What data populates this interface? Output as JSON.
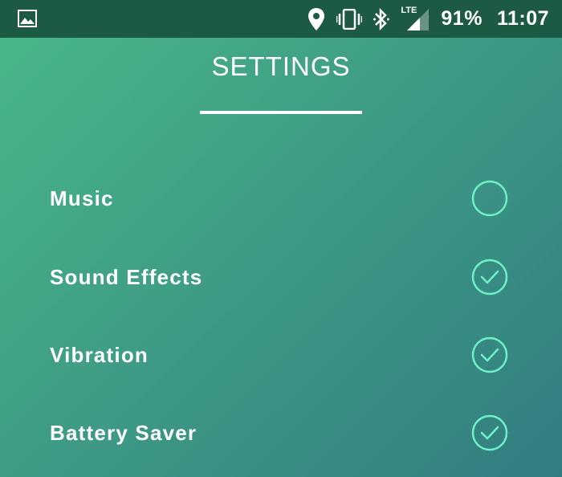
{
  "status_bar": {
    "battery": "91%",
    "time": "11:07",
    "network": "LTE",
    "icons": [
      "image-icon",
      "location-icon",
      "vibrate-icon",
      "bluetooth-icon",
      "lte-signal-icon"
    ]
  },
  "header": {
    "title": "SETTINGS"
  },
  "settings": [
    {
      "label": "Music",
      "checked": false
    },
    {
      "label": "Sound Effects",
      "checked": true
    },
    {
      "label": "Vibration",
      "checked": true
    },
    {
      "label": "Battery Saver",
      "checked": true
    }
  ],
  "colors": {
    "accent": "#6ef0c6",
    "statusbar": "#1d5a43"
  }
}
